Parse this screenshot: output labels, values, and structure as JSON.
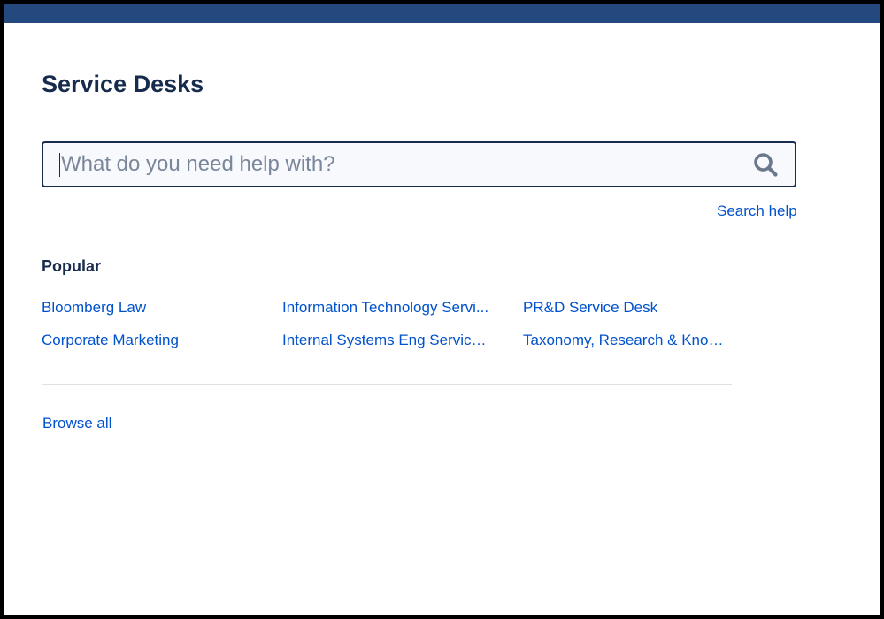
{
  "header": {
    "bar_color": "#23497e"
  },
  "page": {
    "title": "Service Desks"
  },
  "search": {
    "placeholder": "What do you need help with?",
    "value": "",
    "icon": "search-icon",
    "help_link": "Search help"
  },
  "popular": {
    "heading": "Popular",
    "items": [
      {
        "label": "Bloomberg Law"
      },
      {
        "label": "Corporate Marketing"
      },
      {
        "label": "Information Technology Servi..."
      },
      {
        "label": "Internal Systems Eng Service ..."
      },
      {
        "label": "PR&D Service Desk"
      },
      {
        "label": "Taxonomy, Research & Knowl..."
      }
    ]
  },
  "footer": {
    "browse_all": "Browse all"
  },
  "colors": {
    "link": "#0052cc",
    "heading": "#172b4d",
    "search_background": "#f7f9fc"
  }
}
